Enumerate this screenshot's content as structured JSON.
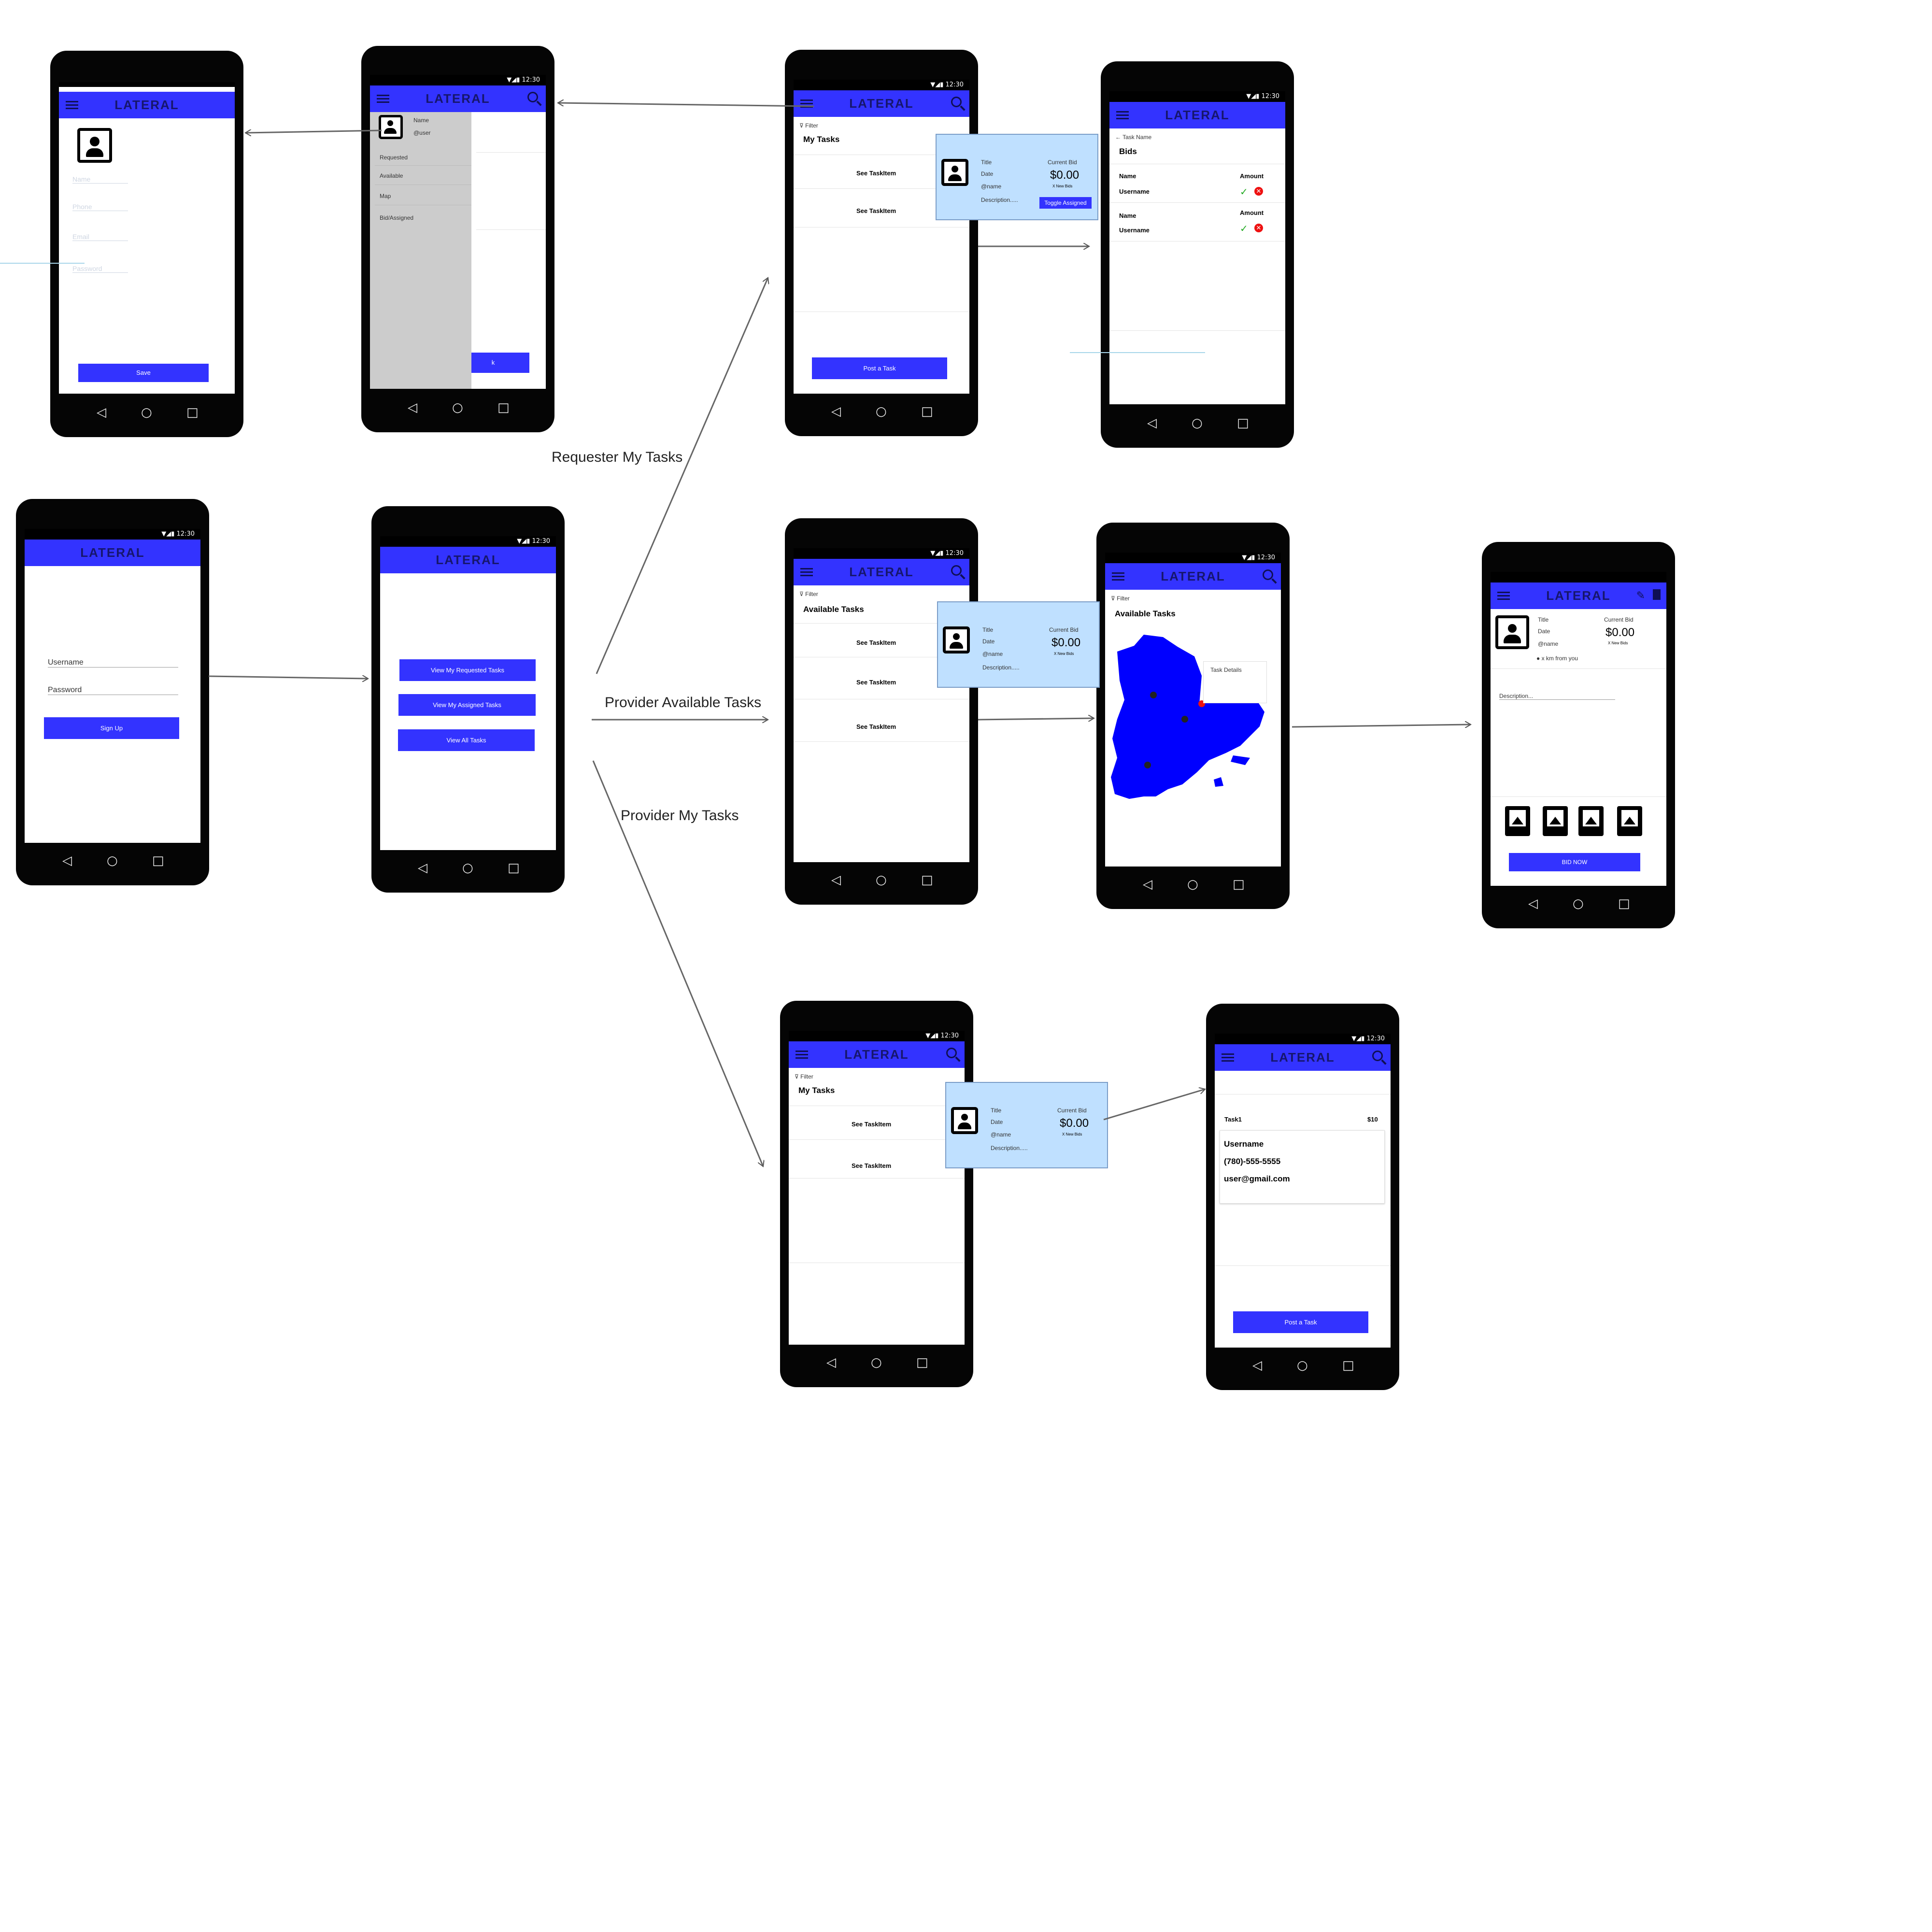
{
  "app": {
    "title": "LATERAL",
    "status_time": "12:30",
    "status_icons": "▼◢▮"
  },
  "nav_glyphs": {
    "back": "◁",
    "home": "○",
    "recent": "□"
  },
  "captions": {
    "requester_my_tasks": "Requester My Tasks",
    "provider_available_tasks": "Provider Available Tasks",
    "provider_my_tasks": "Provider My Tasks"
  },
  "profile_screen": {
    "fields": [
      "Name",
      "Phone",
      "Email",
      "Password"
    ],
    "save_label": "Save"
  },
  "drawer_screen": {
    "name": "Name",
    "user": "@user",
    "items": [
      "Requested",
      "Available",
      "Map",
      "Bid/Assigned"
    ],
    "button_fragment": "k"
  },
  "login_screen": {
    "username_label": "Username",
    "password_label": "Password",
    "signup_label": "Sign Up"
  },
  "home_screen": {
    "buttons": [
      "View My Requested Tasks",
      "View My Assigned Tasks",
      "View All Tasks"
    ]
  },
  "filter_label": "Filter",
  "req_tasks_screen": {
    "heading": "My Tasks",
    "items": [
      "See TaskItem",
      "See TaskItem"
    ],
    "post_label": "Post a Task"
  },
  "task_popup": {
    "title": "Title",
    "date": "Date",
    "name": "@name",
    "description": "Description.....",
    "current_bid_label": "Current Bid",
    "bid_value": "$0.00",
    "new_bids": "X New Bids",
    "toggle_label": "Toggle Assigned"
  },
  "bids_screen": {
    "back_label": "Task Name",
    "heading": "Bids",
    "rows": [
      {
        "name": "Name",
        "username": "Username",
        "amount": "Amount"
      },
      {
        "name": "Name",
        "username": "Username",
        "amount": "Amount"
      }
    ]
  },
  "available_screen": {
    "heading": "Available Tasks",
    "items": [
      "See TaskItem",
      "See TaskItem",
      "See TaskItem"
    ]
  },
  "map_screen": {
    "heading": "Available Tasks",
    "task_details": "Task Details",
    "map_color": "#0000ff"
  },
  "bid_screen": {
    "title": "Title",
    "date": "Date",
    "name": "@name",
    "current_bid_label": "Current Bid",
    "bid_value": "$0.00",
    "new_bids": "X New Bids",
    "distance": "x km from you",
    "description": "Description...",
    "bid_now_label": "BID NOW"
  },
  "prov_tasks_screen": {
    "heading": "My Tasks",
    "items": [
      "See TaskItem",
      "See TaskItem"
    ]
  },
  "contact_screen": {
    "task": "Task1",
    "price": "$10",
    "username": "Username",
    "phone": "(780)-555-5555",
    "email": "user@gmail.com",
    "post_label": "Post a Task"
  }
}
